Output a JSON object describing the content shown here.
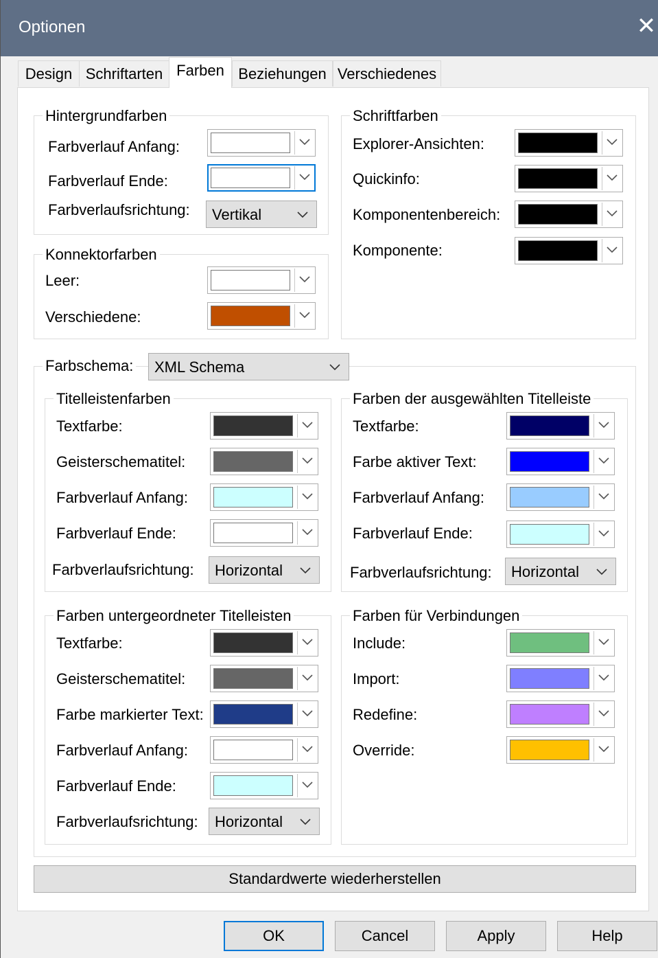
{
  "window": {
    "title": "Optionen",
    "close_glyph": "✕"
  },
  "tabs": [
    "Design",
    "Schriftarten",
    "Farben",
    "Beziehungen",
    "Verschiedenes"
  ],
  "active_tab": "Farben",
  "background_colors": {
    "legend": "Hintergrundfarben",
    "gradient_start": {
      "label": "Farbverlauf Anfang:",
      "color": "#ffffff"
    },
    "gradient_end": {
      "label": "Farbverlauf Ende:",
      "color": "#ffffff"
    },
    "gradient_direction": {
      "label": "Farbverlaufsrichtung:",
      "value": "Vertikal"
    }
  },
  "connector_colors": {
    "legend": "Konnektorfarben",
    "empty": {
      "label": "Leer:",
      "color": "#ffffff"
    },
    "various": {
      "label": "Verschiedene:",
      "color": "#c04f00"
    }
  },
  "font_colors": {
    "legend": "Schriftfarben",
    "explorer": {
      "label": "Explorer-Ansichten:",
      "color": "#000000"
    },
    "quickinfo": {
      "label": "Quickinfo:",
      "color": "#000000"
    },
    "component_area": {
      "label": "Komponentenbereich:",
      "color": "#000000"
    },
    "component": {
      "label": "Komponente:",
      "color": "#000000"
    }
  },
  "scheme": {
    "label": "Farbschema:",
    "value": "XML Schema"
  },
  "titlebar_colors": {
    "legend": "Titelleistenfarben",
    "text_color": {
      "label": "Textfarbe:",
      "color": "#333333"
    },
    "ghost_title": {
      "label": "Geisterschematitel:",
      "color": "#666666"
    },
    "gradient_start": {
      "label": "Farbverlauf Anfang:",
      "color": "#ccffff"
    },
    "gradient_end": {
      "label": "Farbverlauf Ende:",
      "color": "#ffffff"
    },
    "gradient_direction": {
      "label": "Farbverlaufsrichtung:",
      "value": "Horizontal"
    }
  },
  "selected_titlebar_colors": {
    "legend": "Farben der ausgewählten Titelleiste",
    "text_color": {
      "label": "Textfarbe:",
      "color": "#000066"
    },
    "active_text": {
      "label": "Farbe aktiver Text:",
      "color": "#0000ff"
    },
    "gradient_start": {
      "label": "Farbverlauf Anfang:",
      "color": "#99ccff"
    },
    "gradient_end": {
      "label": "Farbverlauf Ende:",
      "color": "#ccffff"
    },
    "gradient_direction": {
      "label": "Farbverlaufsrichtung:",
      "value": "Horizontal"
    }
  },
  "child_titlebar_colors": {
    "legend": "Farben untergeordneter Titelleisten",
    "text_color": {
      "label": "Textfarbe:",
      "color": "#333333"
    },
    "ghost_title": {
      "label": "Geisterschematitel:",
      "color": "#666666"
    },
    "marked_text": {
      "label": "Farbe markierter Text:",
      "color": "#1f3c88"
    },
    "gradient_start": {
      "label": "Farbverlauf Anfang:",
      "color": "#ffffff"
    },
    "gradient_end": {
      "label": "Farbverlauf Ende:",
      "color": "#ccffff"
    },
    "gradient_direction": {
      "label": "Farbverlaufsrichtung:",
      "value": "Horizontal"
    }
  },
  "connection_colors": {
    "legend": "Farben für Verbindungen",
    "include": {
      "label": "Include:",
      "color": "#6fbf7f"
    },
    "import": {
      "label": "Import:",
      "color": "#7f7fff"
    },
    "redefine": {
      "label": "Redefine:",
      "color": "#bf7fff"
    },
    "override": {
      "label": "Override:",
      "color": "#ffc000"
    }
  },
  "buttons": {
    "restore": "Standardwerte wiederherstellen",
    "ok": "OK",
    "cancel": "Cancel",
    "apply": "Apply",
    "help": "Help"
  }
}
